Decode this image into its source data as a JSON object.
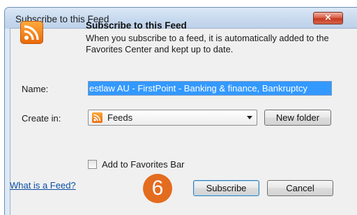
{
  "window": {
    "title": "Subscribe to this Feed",
    "close_label": "×"
  },
  "header": {
    "icon": "rss-feed-icon",
    "heading": "Subscribe to this Feed",
    "description": "When you subscribe to a feed, it is automatically added to the Favorites Center and kept up to date."
  },
  "form": {
    "name_label": "Name:",
    "name_value": "estlaw AU - FirstPoint - Banking & finance, Bankruptcy",
    "create_in_label": "Create in:",
    "create_in_value": "Feeds",
    "new_folder_label": "New folder",
    "favorites_bar_label": "Add to Favorites Bar",
    "favorites_bar_checked": false
  },
  "footer": {
    "help_link": "What is a Feed?",
    "step_badge": "6",
    "subscribe_label": "Subscribe",
    "cancel_label": "Cancel"
  },
  "colors": {
    "accent_orange": "#e36c1f",
    "selection_blue": "#3399ff",
    "link_blue": "#0b4ea2"
  }
}
